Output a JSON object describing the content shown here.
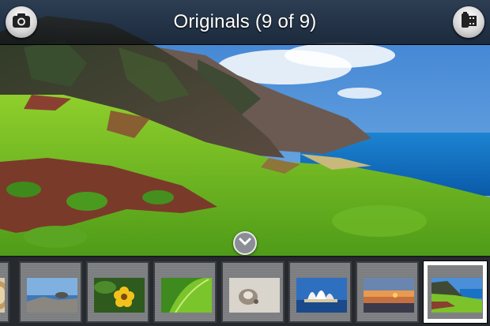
{
  "header": {
    "title": "Originals (9 of 9)",
    "left_icon": "camera-icon",
    "right_icon": "film-roll-icon"
  },
  "filmstrip": {
    "collapse_icon": "chevron-down-icon",
    "thumbnails": [
      {
        "subject": "shell",
        "selected": false
      },
      {
        "subject": "coastal-rocks",
        "selected": false
      },
      {
        "subject": "yellow-flower",
        "selected": false
      },
      {
        "subject": "green-leaf",
        "selected": false
      },
      {
        "subject": "hermit-crab",
        "selected": false
      },
      {
        "subject": "opera-house",
        "selected": false
      },
      {
        "subject": "sunset-beach",
        "selected": false
      },
      {
        "subject": "coastal-cliffs",
        "selected": true
      }
    ]
  },
  "colors": {
    "topbar": "#1c1f24",
    "filmstrip": "#262a2f",
    "selected_border": "#ffffff",
    "sky": "#4a8fd8",
    "ocean": "#0f6fc2",
    "grass": "#7cc22a"
  }
}
